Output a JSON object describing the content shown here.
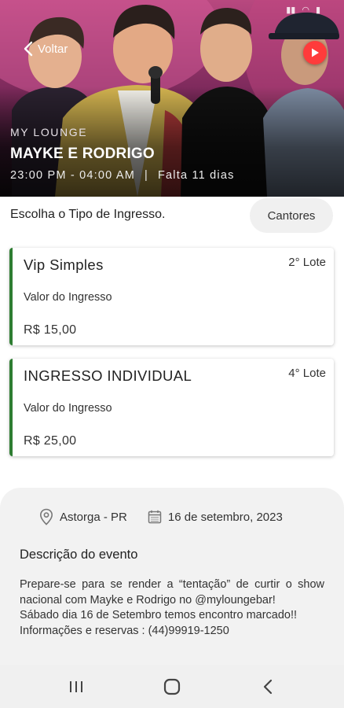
{
  "header": {
    "back_label": "Voltar",
    "venue": "MY LOUNGE",
    "title": "MAYKE E RODRIGO",
    "time": "23:00 PM - 04:00 AM",
    "divider": "|",
    "countdown": "Falta 11 dias",
    "play_icon": "play-icon"
  },
  "tickets": {
    "prompt": "Escolha o Tipo de Ingresso.",
    "singers_button": "Cantores",
    "items": [
      {
        "name": "Vip Simples",
        "lot": "2° Lote",
        "label": "Valor do Ingresso",
        "price": "R$  15,00"
      },
      {
        "name": "INGRESSO INDIVIDUAL",
        "lot": "4° Lote",
        "label": "Valor do Ingresso",
        "price": "R$  25,00"
      }
    ],
    "accent_color": "#2e7d32"
  },
  "details": {
    "location": "Astorga - PR",
    "date": "16 de setembro, 2023",
    "description_title": "Descrição do evento",
    "description_lines": [
      "Prepare-se para se render a “tentação” de curtir o show nacional com Mayke e Rodrigo no @myloungebar!",
      "Sábado dia 16 de Setembro temos encontro marcado!!",
      "Informações e reservas : (44)99919-1250"
    ]
  },
  "navbar": {
    "recents_icon": "recents-icon",
    "home_icon": "home-icon",
    "back_icon": "back-icon"
  },
  "colors": {
    "play_button": "#ff3b3b",
    "details_bg": "#f2f2f2",
    "hero_magenta": "#b8487f"
  }
}
